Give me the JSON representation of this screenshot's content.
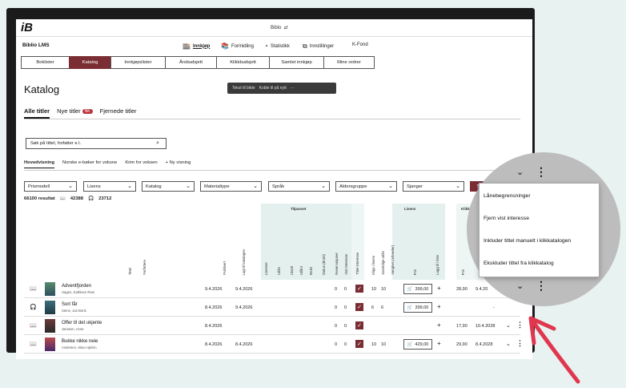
{
  "topbar": {
    "logo": "iB",
    "center_label": "Biblo",
    "swap_icon": "swap-arrows-icon"
  },
  "appbar": {
    "app_name": "Biblio LMS",
    "menu": [
      {
        "label": "Innkjøp",
        "icon": "shop-icon"
      },
      {
        "label": "Formidling",
        "icon": "books-icon"
      },
      {
        "label": "Statistikk",
        "icon": "chart-icon"
      },
      {
        "label": "Innstillinger",
        "icon": "hierarchy-icon"
      },
      {
        "label": "K-Fond",
        "icon": ""
      }
    ]
  },
  "subtabs": [
    "Boklister",
    "Katalog",
    "Innkjøpslister",
    "Årsbudsjett",
    "Klikkbudsjett",
    "Samlet innkjøp",
    "Mine ordrer"
  ],
  "page_title": "Katalog",
  "floatbar": {
    "item1": "Tekst til bilde",
    "item2": "Koble til på nytt",
    "more": "···"
  },
  "title_tabs": {
    "all": "Alle titler",
    "new": "Nye titler",
    "new_badge": "NK",
    "removed": "Fjernede titler"
  },
  "search": {
    "placeholder": "Søk på tittel, forfatter e.l."
  },
  "views": [
    "Hovedvisning",
    "Norske e-bøker for voksne",
    "Krim for voksen",
    "+ Ny visning"
  ],
  "filters": [
    "Prismodell",
    "Lisens",
    "Katalog",
    "Materialtype",
    "Språk",
    "Aldersgruppe",
    "Sjanger"
  ],
  "results": {
    "count": "66100 resultat",
    "books": "42388",
    "audio": "23712"
  },
  "table_head": {
    "group_tilpasset": "Tilpasset",
    "group_lisens": "Lisens",
    "group_klikk": "Klikk",
    "cols": [
      "Tittel",
      "Forfattere",
      "Publisert",
      "Lagt til katalogen",
      "Lisenser",
      "Utlån",
      "Utsatt",
      "Utlånt",
      "Brukt",
      "Status (Brukt)",
      "Reservasjoner",
      "Vist interesse",
      "Tittel interesse",
      "Klipp i lisens",
      "Samtidige utlån",
      "Varighet (måneder)",
      "Pris",
      "Lagg til i liste",
      "Pris"
    ]
  },
  "rows": [
    {
      "title": "Adventfjorden",
      "author": "Hagen, Kathleen Rani",
      "publ": "9.4.2026",
      "added": "9.4.2026",
      "res": "0",
      "vi": "0",
      "c1": "10",
      "c2": "10",
      "price": "399,00",
      "kprice": "28,90",
      "kdate": "9.4.20"
    },
    {
      "title": "Sort får",
      "author": "Stene, Jan Boris",
      "publ": "8.4.2026",
      "added": "9.4.2026",
      "res": "0",
      "vi": "0",
      "c1": "6",
      "c2": "6",
      "price": "399,00",
      "kprice": "",
      "kdate": ""
    },
    {
      "title": "Offer til det ukjente",
      "author": "Jansson, Anna",
      "publ": "8.4.2026",
      "added": "",
      "res": "0",
      "vi": "0",
      "c1": "",
      "c2": "",
      "price": "",
      "kprice": "17,90",
      "kdate": "10.4.2028"
    },
    {
      "title": "Bukke nikke neie",
      "author": "Andersen, Stian Hjelvin",
      "publ": "8.4.2026",
      "added": "8.4.2026",
      "res": "0",
      "vi": "0",
      "c1": "10",
      "c2": "10",
      "price": "429,00",
      "kprice": "29,90",
      "kdate": "8.4.2028"
    }
  ],
  "popup": {
    "items": [
      "Lånebegrensninger",
      "Fjern vist interesse",
      "Inkluder tittel manuelt i klikkatalogen",
      "Ekskluder tittel fra klikkatalog"
    ]
  },
  "magnify": {
    "label_klikk": "Klikk",
    "date_peek": "9.4.20",
    "date_peek2": "9.4.20"
  },
  "accent_color": "#7a2d33",
  "arrow_color": "#e0374f"
}
